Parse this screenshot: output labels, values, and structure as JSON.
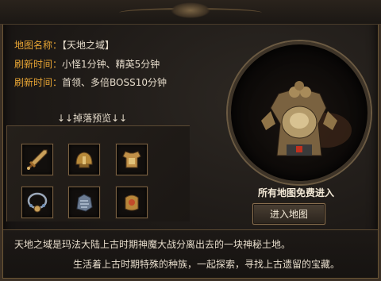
{
  "map_info": {
    "name_label": "地图名称：",
    "name_value": "【天地之域】",
    "refresh1_label": "刷新时间：",
    "refresh1_value": "小怪1分钟、精英5分钟",
    "refresh2_label": "刷新时间：",
    "refresh2_value": "首领、多倍BOSS10分钟"
  },
  "drops": {
    "title": "↓↓掉落预览↓↓",
    "items": [
      {
        "icon": "sword-icon"
      },
      {
        "icon": "gold-helmet-icon"
      },
      {
        "icon": "gold-armor-icon"
      },
      {
        "icon": "silver-necklace-icon"
      },
      {
        "icon": "blue-gauntlet-icon"
      },
      {
        "icon": "gold-bracer-icon"
      }
    ]
  },
  "boss": {
    "icon": "armored-demon-boss-icon"
  },
  "entry": {
    "free_text": "所有地图免费进入",
    "button_label": "进入地图"
  },
  "description": {
    "line1": "天地之域是玛法大陆上古时期神魔大战分离出去的一块神秘土地。",
    "line2": "生活着上古时期特殊的种族，一起探索，寻找上古遗留的宝藏。"
  },
  "colors": {
    "label": "#e8a534",
    "text": "#e6dccb",
    "border": "#6b5638"
  }
}
